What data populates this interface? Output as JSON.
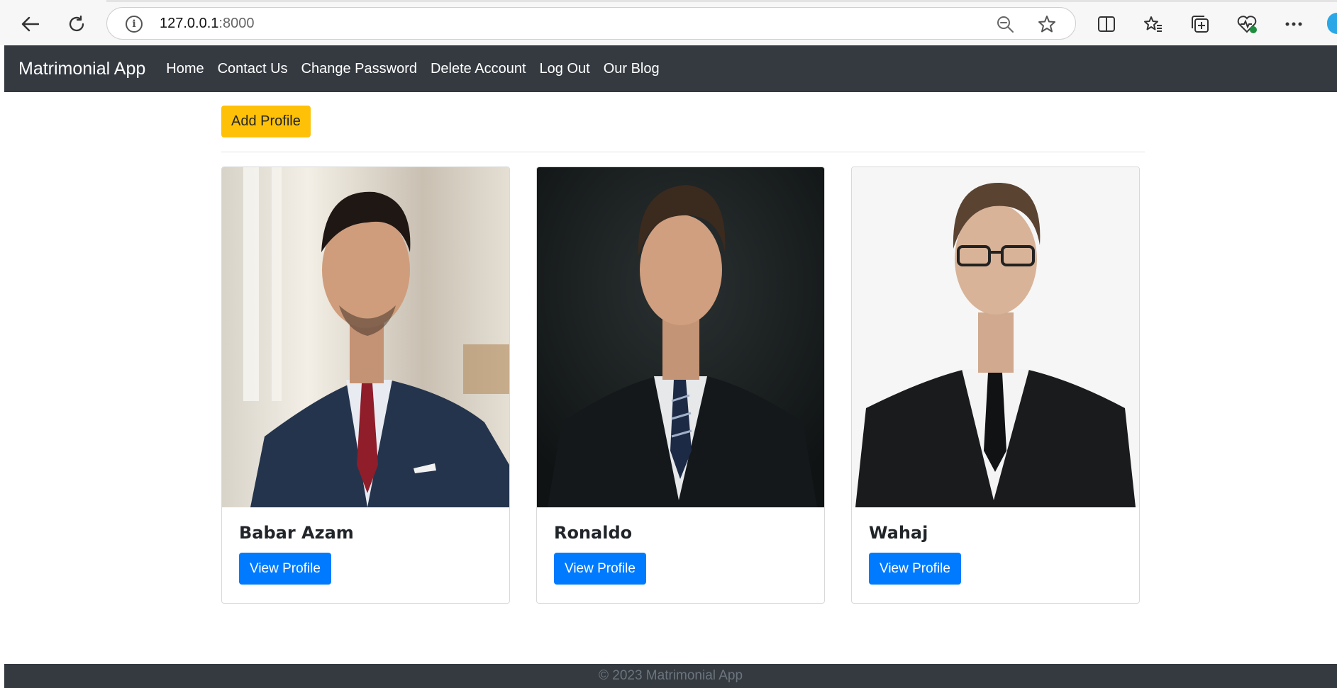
{
  "browser": {
    "url_host": "127.0.0.1",
    "url_port": ":8000",
    "colors": {
      "chrome_bg": "#f7f7f7"
    }
  },
  "navbar": {
    "brand": "Matrimonial App",
    "links": [
      "Home",
      "Contact Us",
      "Change Password",
      "Delete Account",
      "Log Out",
      "Our Blog"
    ]
  },
  "main": {
    "add_button": "Add Profile",
    "profiles": [
      {
        "name": "Babar Azam",
        "button": "View Profile"
      },
      {
        "name": "Ronaldo",
        "button": "View Profile"
      },
      {
        "name": "Wahaj",
        "button": "View Profile"
      }
    ]
  },
  "footer": {
    "text": "© 2023 Matrimonial App"
  },
  "colors": {
    "navbar": "#343a40",
    "add_button": "#ffc107",
    "view_button": "#007bff"
  }
}
